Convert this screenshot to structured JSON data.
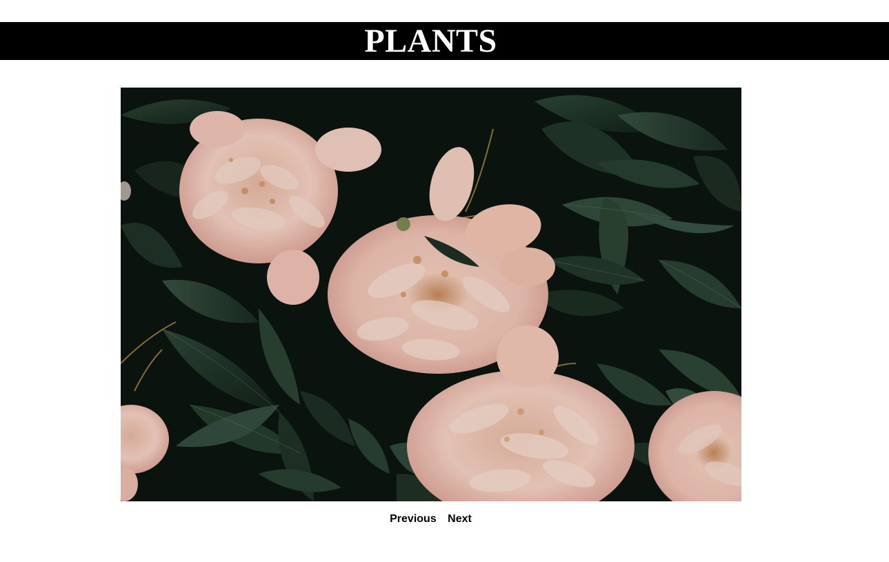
{
  "header": {
    "title": "PLANTS",
    "background": "#000000",
    "text_color": "#ffffff"
  },
  "gallery": {
    "image_subject": "pink peony flowers among dark green leaves"
  },
  "pager": {
    "previous_label": "Previous",
    "next_label": "Next"
  }
}
